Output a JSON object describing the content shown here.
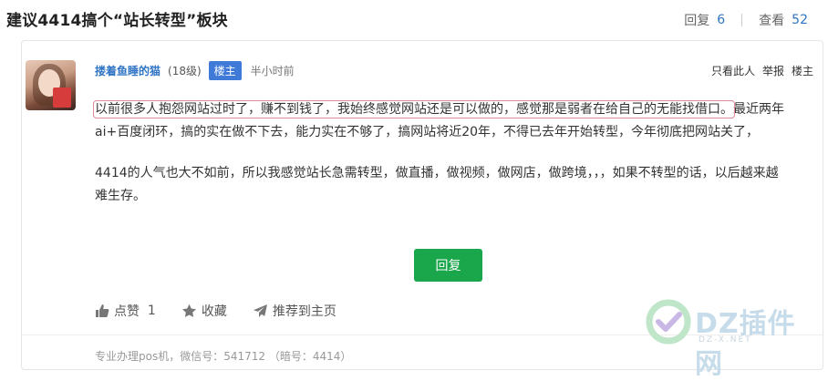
{
  "thread": {
    "title": "建议4414搞个“站长转型”板块",
    "reply_label": "回复",
    "reply_count": "6",
    "view_label": "查看",
    "view_count": "52"
  },
  "post": {
    "author": "搂着鱼睡的猫",
    "level": "(18级)",
    "badge": "楼主",
    "time": "半小时前",
    "actions": [
      "只看此人",
      "举报",
      "楼主"
    ],
    "content_highlight": "以前很多人抱怨网站过时了，赚不到钱了，我始终感觉网站还是可以做的，感觉那是弱者在给自己的无能找借口。",
    "content_rest": "最近两年ai+百度闭环，搞的实在做不下去，能力实在不够了，搞网站将近20年，不得已去年开始转型，今年彻底把网站关了，",
    "content_p2": "4414的人气也大不如前，所以我感觉站长急需转型，做直播，做视频，做网店，做跨境，，，如果不转型的话，以后越来越难生存。",
    "reply_button": "回复",
    "like_label": "点赞",
    "like_count": "1",
    "favorite_label": "收藏",
    "recommend_label": "推荐到主页",
    "signature": "专业办理pos机，微信号：541712 （暗号：4414）"
  },
  "watermark": {
    "text": "DZ插件网",
    "url": "DZ-X.NET"
  },
  "colors": {
    "link": "#2f74c4",
    "badge": "#3f7ad9",
    "reply_button": "#1aa64a",
    "highlight_border": "#e08a9c"
  }
}
